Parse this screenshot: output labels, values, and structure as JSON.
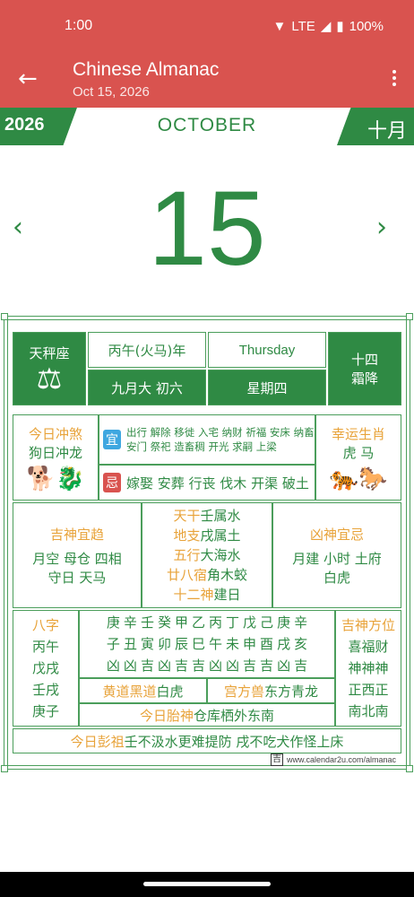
{
  "status": {
    "time": "1:00",
    "network": "LTE",
    "battery": "100%"
  },
  "appbar": {
    "title": "Chinese Almanac",
    "subtitle": "Oct 15, 2026"
  },
  "calendar": {
    "year": "2026",
    "month": "OCTOBER",
    "chinese_month": "十月",
    "day": "15"
  },
  "top_row": {
    "zodiac_sign": "天秤座",
    "ganzhi_year": "丙午(火马)年",
    "weekday_en": "Thursday",
    "solar_term_day": "十四",
    "solar_term": "霜降",
    "lunar_date": "九月大 初六",
    "weekday_cn": "星期四"
  },
  "clash": {
    "title": "今日冲煞",
    "value": "狗日冲龙"
  },
  "yi": {
    "badge": "宜",
    "text": "出行 解除 移徙 入宅 纳财 祈福 安床 纳畜 安门 祭祀 造畜稠 开光 求嗣 上梁"
  },
  "ji": {
    "badge": "忌",
    "text": "嫁娶 安葬 行丧 伐木 开渠 破土"
  },
  "lucky_zodiac": {
    "title": "幸运生肖",
    "value": "虎 马"
  },
  "good_spirits": {
    "title": "吉神宜趋",
    "lines": [
      "月空 母仓 四相",
      "守日 天马"
    ]
  },
  "middle": {
    "rows": [
      {
        "label": "天干",
        "value": "壬属水"
      },
      {
        "label": "地支",
        "value": "戌属土"
      },
      {
        "label": "五行",
        "value": "大海水"
      },
      {
        "label": "廿八宿",
        "value": "角木蛟"
      },
      {
        "label": "十二神",
        "value": "建日"
      }
    ]
  },
  "bad_spirits": {
    "title": "凶神宜忌",
    "lines": [
      "月建 小时 土府",
      "白虎"
    ]
  },
  "bazi": {
    "title": "八字",
    "values": [
      "丙午",
      "戊戌",
      "壬戌",
      "庚子"
    ]
  },
  "hours": {
    "stems": [
      "庚",
      "辛",
      "壬",
      "癸",
      "甲",
      "乙",
      "丙",
      "丁",
      "戊",
      "己",
      "庚",
      "辛"
    ],
    "branches": [
      "子",
      "丑",
      "寅",
      "卯",
      "辰",
      "巳",
      "午",
      "未",
      "申",
      "酉",
      "戌",
      "亥"
    ],
    "luck": [
      "凶",
      "凶",
      "吉",
      "凶",
      "吉",
      "吉",
      "凶",
      "凶",
      "吉",
      "吉",
      "凶",
      "吉"
    ]
  },
  "huangdao": {
    "label": "黄道黑道",
    "value": "白虎"
  },
  "gongfang": {
    "label": "宫方兽",
    "value": "东方青龙"
  },
  "taishen": {
    "label": "今日胎神",
    "value": "仓库栖外东南"
  },
  "directions": {
    "title": "吉神方位",
    "values": [
      "喜福财",
      "神神神",
      "正西正",
      "南北南"
    ]
  },
  "pengzu": {
    "label": "今日彭祖",
    "value": "壬不汲水更难提防 戌不吃犬作怪上床"
  },
  "footer": {
    "logo": "吉",
    "url": "www.calendar2u.com/almanac"
  }
}
